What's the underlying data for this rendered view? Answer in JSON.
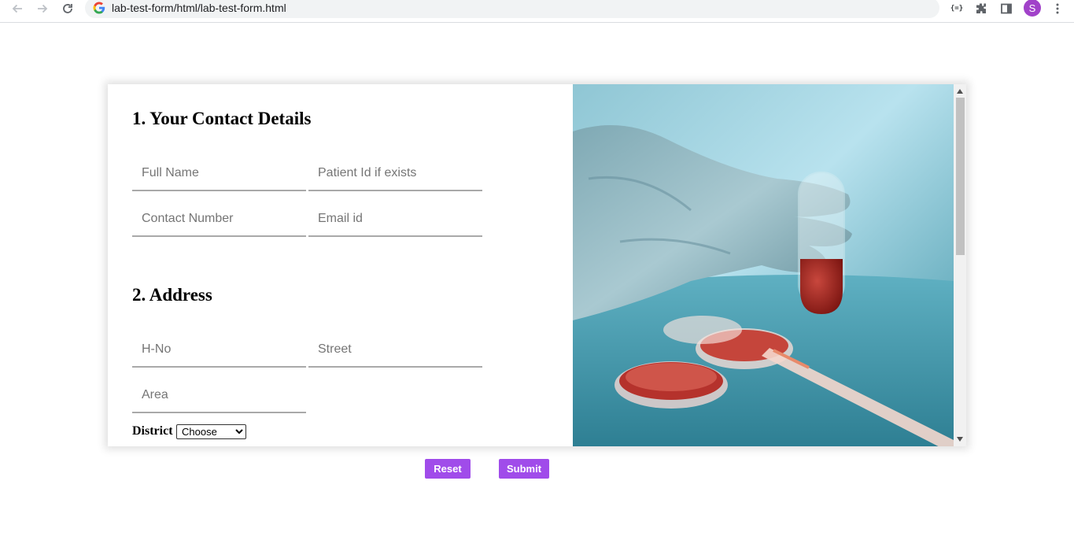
{
  "browser": {
    "url": "lab-test-form/html/lab-test-form.html",
    "profile_initial": "S",
    "json_ext_label": "{=}",
    "icons": [
      "back-arrow-icon",
      "forward-arrow-icon",
      "reload-icon",
      "google-icon",
      "extensions-icon",
      "side-panel-icon",
      "more-menu-icon"
    ]
  },
  "form": {
    "contact": {
      "title": "1. Your Contact Details",
      "full_name_placeholder": "Full Name",
      "patient_id_placeholder": "Patient Id if exists",
      "contact_number_placeholder": "Contact Number",
      "email_placeholder": "Email id"
    },
    "address": {
      "title": "2. Address",
      "hno_placeholder": "H-No",
      "street_placeholder": "Street",
      "area_placeholder": "Area",
      "district_label": "District",
      "district_selected": "Choose"
    },
    "buttons": {
      "reset_label": "Reset",
      "submit_label": "Submit"
    }
  },
  "colors": {
    "accent": "#a04cea",
    "avatar": "#a142c9",
    "field_underline": "#a9a9a9"
  }
}
